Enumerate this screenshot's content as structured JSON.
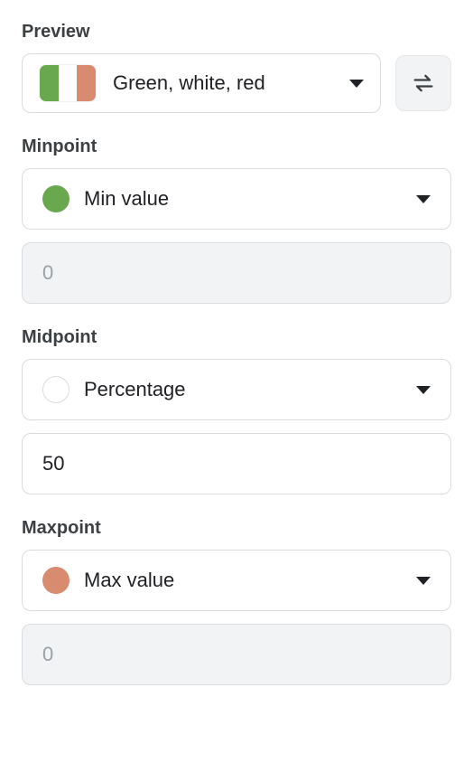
{
  "preview": {
    "label": "Preview",
    "selected_text": "Green, white, red",
    "colors": {
      "start": "#6aa84f",
      "mid": "#ffffff",
      "end": "#d88b6e"
    }
  },
  "minpoint": {
    "label": "Minpoint",
    "selected_text": "Min value",
    "dot_color": "#6aa84f",
    "value_placeholder": "0",
    "value": "",
    "disabled": true
  },
  "midpoint": {
    "label": "Midpoint",
    "selected_text": "Percentage",
    "dot_color": "#ffffff",
    "dot_border": "#dadce0",
    "value": "50",
    "disabled": false
  },
  "maxpoint": {
    "label": "Maxpoint",
    "selected_text": "Max value",
    "dot_color": "#d88b6e",
    "value_placeholder": "0",
    "value": "",
    "disabled": true
  }
}
